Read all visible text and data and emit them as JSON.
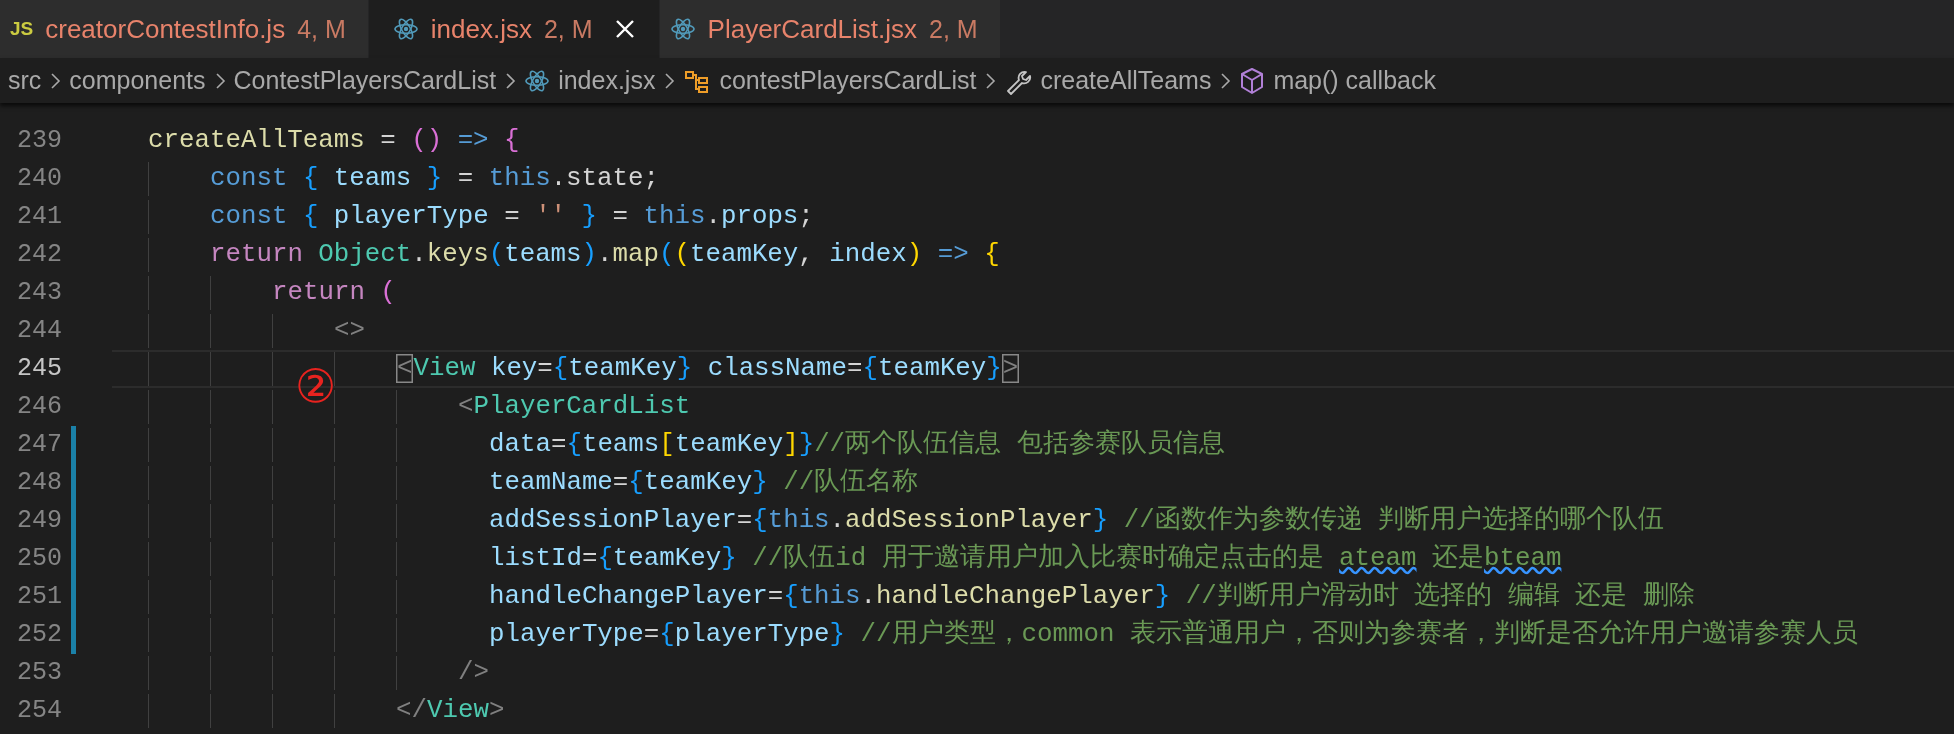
{
  "tabs": [
    {
      "label": "creatorContestInfo.js",
      "badge": "4, M",
      "kind": "js",
      "icon_text": "JS",
      "selected": false
    },
    {
      "label": "index.jsx",
      "badge": "2, M",
      "kind": "react",
      "selected": true
    },
    {
      "label": "PlayerCardList.jsx",
      "badge": "2, M",
      "kind": "react",
      "selected": false
    }
  ],
  "breadcrumbs": [
    {
      "label": "src",
      "kind": "folder"
    },
    {
      "label": "components",
      "kind": "folder"
    },
    {
      "label": "ContestPlayersCardList",
      "kind": "folder"
    },
    {
      "label": "index.jsx",
      "kind": "react"
    },
    {
      "label": "contestPlayersCardList",
      "kind": "class"
    },
    {
      "label": "createAllTeams",
      "kind": "method"
    },
    {
      "label": "map() callback",
      "kind": "callback"
    }
  ],
  "lines": [
    {
      "number": "239",
      "current": false,
      "modified": false,
      "tokens": [
        {
          "kind": "fn",
          "text": "createAllTeams"
        },
        {
          "kind": "op",
          "text": " = "
        },
        {
          "kind": "b2",
          "text": "()"
        },
        {
          "kind": "kw",
          "text": " =>"
        },
        {
          "kind": "b2",
          "text": " {"
        }
      ]
    },
    {
      "number": "240",
      "current": false,
      "modified": false,
      "tokens": [
        {
          "kind": "kw",
          "text": "    const"
        },
        {
          "kind": "b3",
          "text": " {"
        },
        {
          "kind": "var",
          "text": " teams "
        },
        {
          "kind": "b3",
          "text": "}"
        },
        {
          "kind": "op",
          "text": " = "
        },
        {
          "kind": "kw",
          "text": "this"
        },
        {
          "kind": "op",
          "text": ".state;"
        }
      ]
    },
    {
      "number": "241",
      "current": false,
      "modified": false,
      "tokens": [
        {
          "kind": "kw",
          "text": "    const"
        },
        {
          "kind": "b3",
          "text": " {"
        },
        {
          "kind": "var",
          "text": " playerType"
        },
        {
          "kind": "op",
          "text": " = "
        },
        {
          "kind": "str",
          "text": "''"
        },
        {
          "kind": "b3",
          "text": " }"
        },
        {
          "kind": "op",
          "text": " = "
        },
        {
          "kind": "kw",
          "text": "this"
        },
        {
          "kind": "op",
          "text": "."
        },
        {
          "kind": "var",
          "text": "props"
        },
        {
          "kind": "op",
          "text": ";"
        }
      ]
    },
    {
      "number": "242",
      "current": false,
      "modified": false,
      "tokens": [
        {
          "kind": "ctl",
          "text": "    return"
        },
        {
          "kind": "cls",
          "text": " Object"
        },
        {
          "kind": "op",
          "text": "."
        },
        {
          "kind": "fn",
          "text": "keys"
        },
        {
          "kind": "b3",
          "text": "("
        },
        {
          "kind": "var",
          "text": "teams"
        },
        {
          "kind": "b3",
          "text": ")"
        },
        {
          "kind": "op",
          "text": "."
        },
        {
          "kind": "fn",
          "text": "map"
        },
        {
          "kind": "b3",
          "text": "("
        },
        {
          "kind": "b1",
          "text": "("
        },
        {
          "kind": "var",
          "text": "teamKey"
        },
        {
          "kind": "op",
          "text": ", "
        },
        {
          "kind": "var",
          "text": "index"
        },
        {
          "kind": "b1",
          "text": ")"
        },
        {
          "kind": "kw",
          "text": " =>"
        },
        {
          "kind": "b1",
          "text": " {"
        }
      ]
    },
    {
      "number": "243",
      "current": false,
      "modified": false,
      "tokens": [
        {
          "kind": "ctl",
          "text": "        return"
        },
        {
          "kind": "b2",
          "text": " ("
        }
      ]
    },
    {
      "number": "244",
      "current": false,
      "modified": false,
      "tokens": [
        {
          "kind": "tag",
          "text": "            <>"
        }
      ]
    },
    {
      "number": "245",
      "current": true,
      "modified": false,
      "tokens": [
        {
          "kind": "tagm",
          "text": "                <"
        },
        {
          "kind": "cls",
          "text": "View"
        },
        {
          "kind": "var",
          "text": " key"
        },
        {
          "kind": "op",
          "text": "="
        },
        {
          "kind": "b3",
          "text": "{"
        },
        {
          "kind": "var",
          "text": "teamKey"
        },
        {
          "kind": "b3",
          "text": "}"
        },
        {
          "kind": "var",
          "text": " className"
        },
        {
          "kind": "op",
          "text": "="
        },
        {
          "kind": "b3",
          "text": "{"
        },
        {
          "kind": "var",
          "text": "teamKey"
        },
        {
          "kind": "b3",
          "text": "}"
        },
        {
          "kind": "tagm",
          "text": ">"
        }
      ]
    },
    {
      "number": "246",
      "current": false,
      "modified": false,
      "tokens": [
        {
          "kind": "tag",
          "text": "                    <"
        },
        {
          "kind": "cls",
          "text": "PlayerCardList"
        }
      ]
    },
    {
      "number": "247",
      "current": false,
      "modified": true,
      "tokens": [
        {
          "kind": "var",
          "text": "                      data"
        },
        {
          "kind": "op",
          "text": "="
        },
        {
          "kind": "b3",
          "text": "{"
        },
        {
          "kind": "var",
          "text": "teams"
        },
        {
          "kind": "b1",
          "text": "["
        },
        {
          "kind": "var",
          "text": "teamKey"
        },
        {
          "kind": "b1",
          "text": "]"
        },
        {
          "kind": "b3",
          "text": "}"
        },
        {
          "kind": "cmt",
          "text": "//两个队伍信息 包括参赛队员信息"
        }
      ]
    },
    {
      "number": "248",
      "current": false,
      "modified": true,
      "tokens": [
        {
          "kind": "var",
          "text": "                      teamName"
        },
        {
          "kind": "op",
          "text": "="
        },
        {
          "kind": "b3",
          "text": "{"
        },
        {
          "kind": "var",
          "text": "teamKey"
        },
        {
          "kind": "b3",
          "text": "}"
        },
        {
          "kind": "cmt",
          "text": " //队伍名称"
        }
      ]
    },
    {
      "number": "249",
      "current": false,
      "modified": true,
      "tokens": [
        {
          "kind": "var",
          "text": "                      addSessionPlayer"
        },
        {
          "kind": "op",
          "text": "="
        },
        {
          "kind": "b3",
          "text": "{"
        },
        {
          "kind": "kw",
          "text": "this"
        },
        {
          "kind": "op",
          "text": "."
        },
        {
          "kind": "fn",
          "text": "addSessionPlayer"
        },
        {
          "kind": "b3",
          "text": "}"
        },
        {
          "kind": "cmt",
          "text": " //函数作为参数传递 判断用户选择的哪个队伍"
        }
      ]
    },
    {
      "number": "250",
      "current": false,
      "modified": true,
      "tokens": [
        {
          "kind": "var",
          "text": "                      listId"
        },
        {
          "kind": "op",
          "text": "="
        },
        {
          "kind": "b3",
          "text": "{"
        },
        {
          "kind": "var",
          "text": "teamKey"
        },
        {
          "kind": "b3",
          "text": "}"
        },
        {
          "kind": "cmt",
          "text": " //队伍id 用于邀请用户加入比赛时确定点击的是 "
        },
        {
          "kind": "cmtw",
          "text": "ateam"
        },
        {
          "kind": "cmt",
          "text": " 还是"
        },
        {
          "kind": "cmtw",
          "text": "bteam"
        }
      ]
    },
    {
      "number": "251",
      "current": false,
      "modified": true,
      "tokens": [
        {
          "kind": "var",
          "text": "                      handleChangePlayer"
        },
        {
          "kind": "op",
          "text": "="
        },
        {
          "kind": "b3",
          "text": "{"
        },
        {
          "kind": "kw",
          "text": "this"
        },
        {
          "kind": "op",
          "text": "."
        },
        {
          "kind": "fn",
          "text": "handleChangePlayer"
        },
        {
          "kind": "b3",
          "text": "}"
        },
        {
          "kind": "cmt",
          "text": " //判断用户滑动时 选择的 编辑 还是 删除"
        }
      ]
    },
    {
      "number": "252",
      "current": false,
      "modified": true,
      "tokens": [
        {
          "kind": "var",
          "text": "                      playerType"
        },
        {
          "kind": "op",
          "text": "="
        },
        {
          "kind": "b3",
          "text": "{"
        },
        {
          "kind": "var",
          "text": "playerType"
        },
        {
          "kind": "b3",
          "text": "}"
        },
        {
          "kind": "cmt",
          "text": " //用户类型，common 表示普通用户，否则为参赛者，判断是否允许用户邀请参赛人员"
        }
      ]
    },
    {
      "number": "253",
      "current": false,
      "modified": false,
      "tokens": [
        {
          "kind": "tag",
          "text": "                    />"
        }
      ]
    },
    {
      "number": "254",
      "current": false,
      "modified": false,
      "tokens": [
        {
          "kind": "tag",
          "text": "                </"
        },
        {
          "kind": "cls",
          "text": "View"
        },
        {
          "kind": "tag",
          "text": ">"
        }
      ]
    }
  ],
  "annotation": {
    "text": "②"
  }
}
